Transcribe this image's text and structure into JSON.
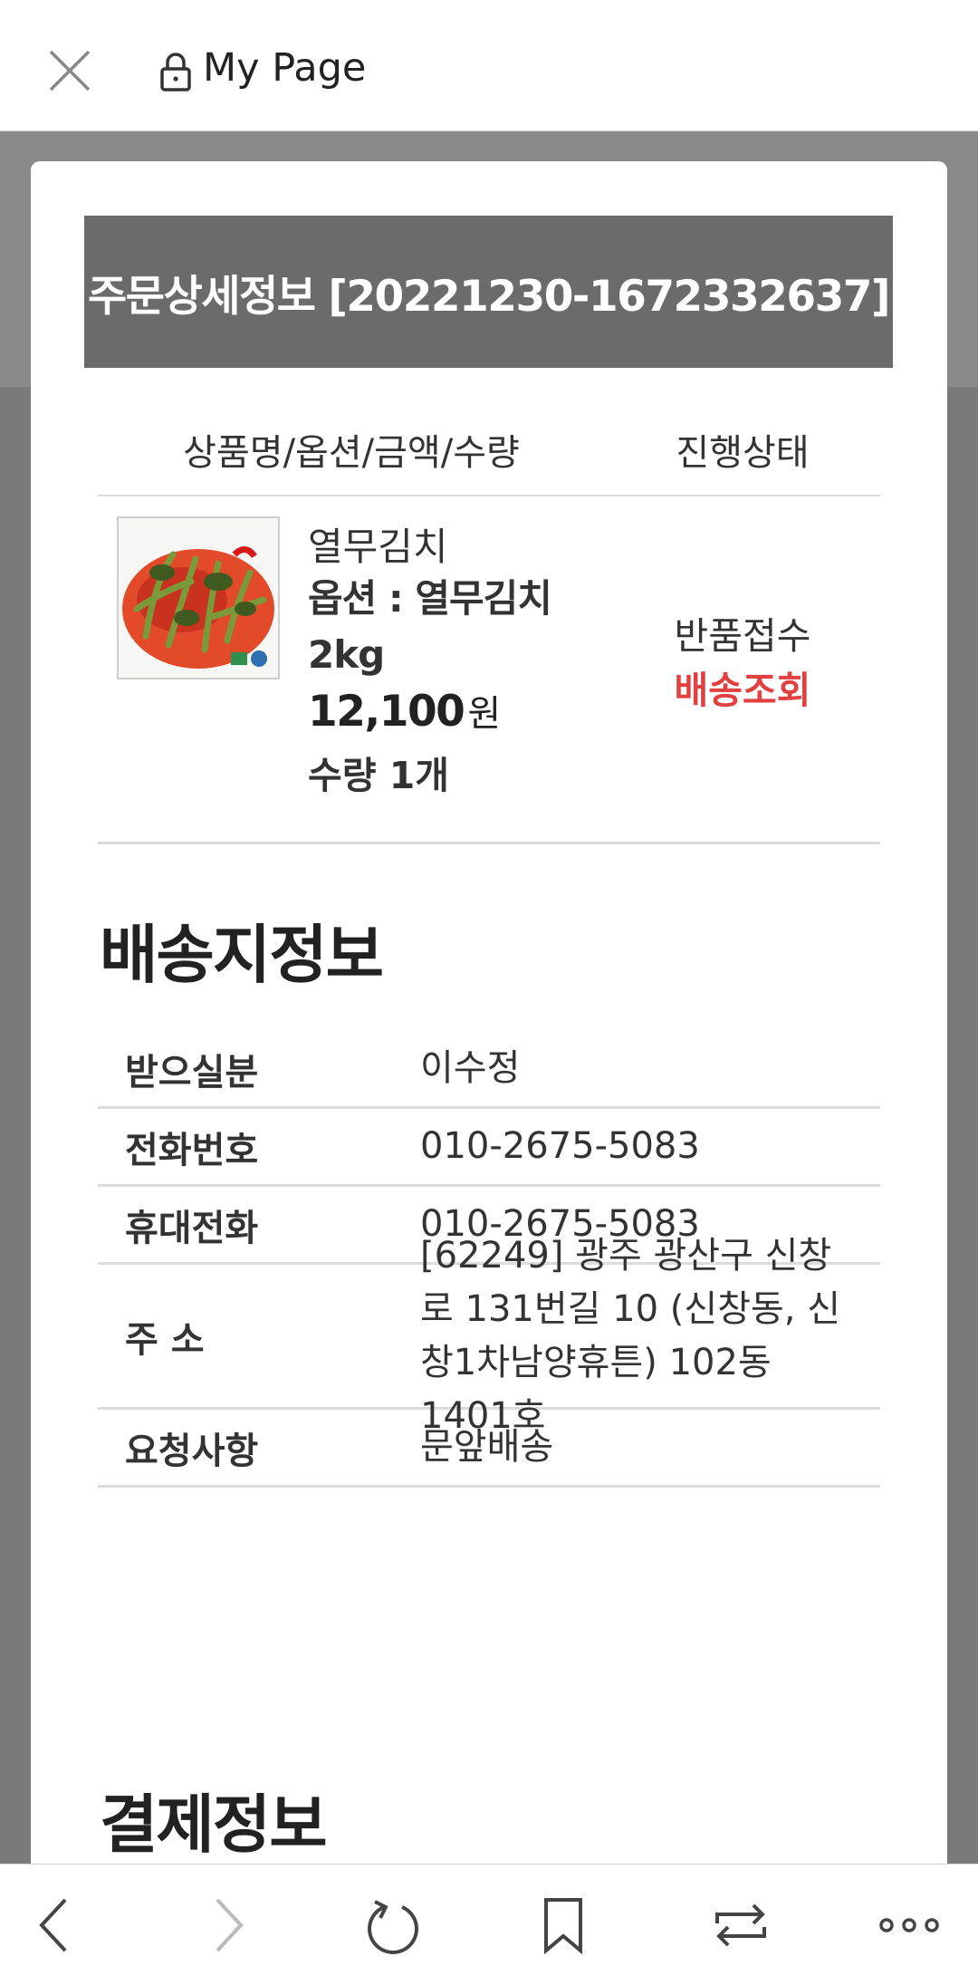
{
  "topbar": {
    "title": "My Page"
  },
  "header": {
    "title": "주문상세정보 [20221230-1672332637]"
  },
  "table_head": {
    "col1": "상품명/옵션/금액/수량",
    "col2": "진행상태"
  },
  "item": {
    "name": "열무김치",
    "option": "옵션 : 열무김치 2kg",
    "price": "12,100",
    "currency": "원",
    "quantity": "수량 1개",
    "status": "반품접수",
    "tracking_link": "배송조회",
    "image_icon": "kimchi-product-photo"
  },
  "shipping": {
    "title": "배송지정보",
    "rows": [
      {
        "label": "받으실분",
        "value": "이수정"
      },
      {
        "label": "전화번호",
        "value": "010-2675-5083"
      },
      {
        "label": "휴대전화",
        "value": "010-2675-5083"
      },
      {
        "label": "주 소",
        "value": "[62249] 광주 광산구 신창로 131번길 10 (신창동, 신창1차남양휴튼) 102동 1401호"
      },
      {
        "label": "요청사항",
        "value": "문앞배송"
      }
    ]
  },
  "payment": {
    "title": "결제정보"
  },
  "colors": {
    "header_bg": "#6b6b6b",
    "status_link": "#e04040",
    "divider": "#dcdcdc"
  }
}
